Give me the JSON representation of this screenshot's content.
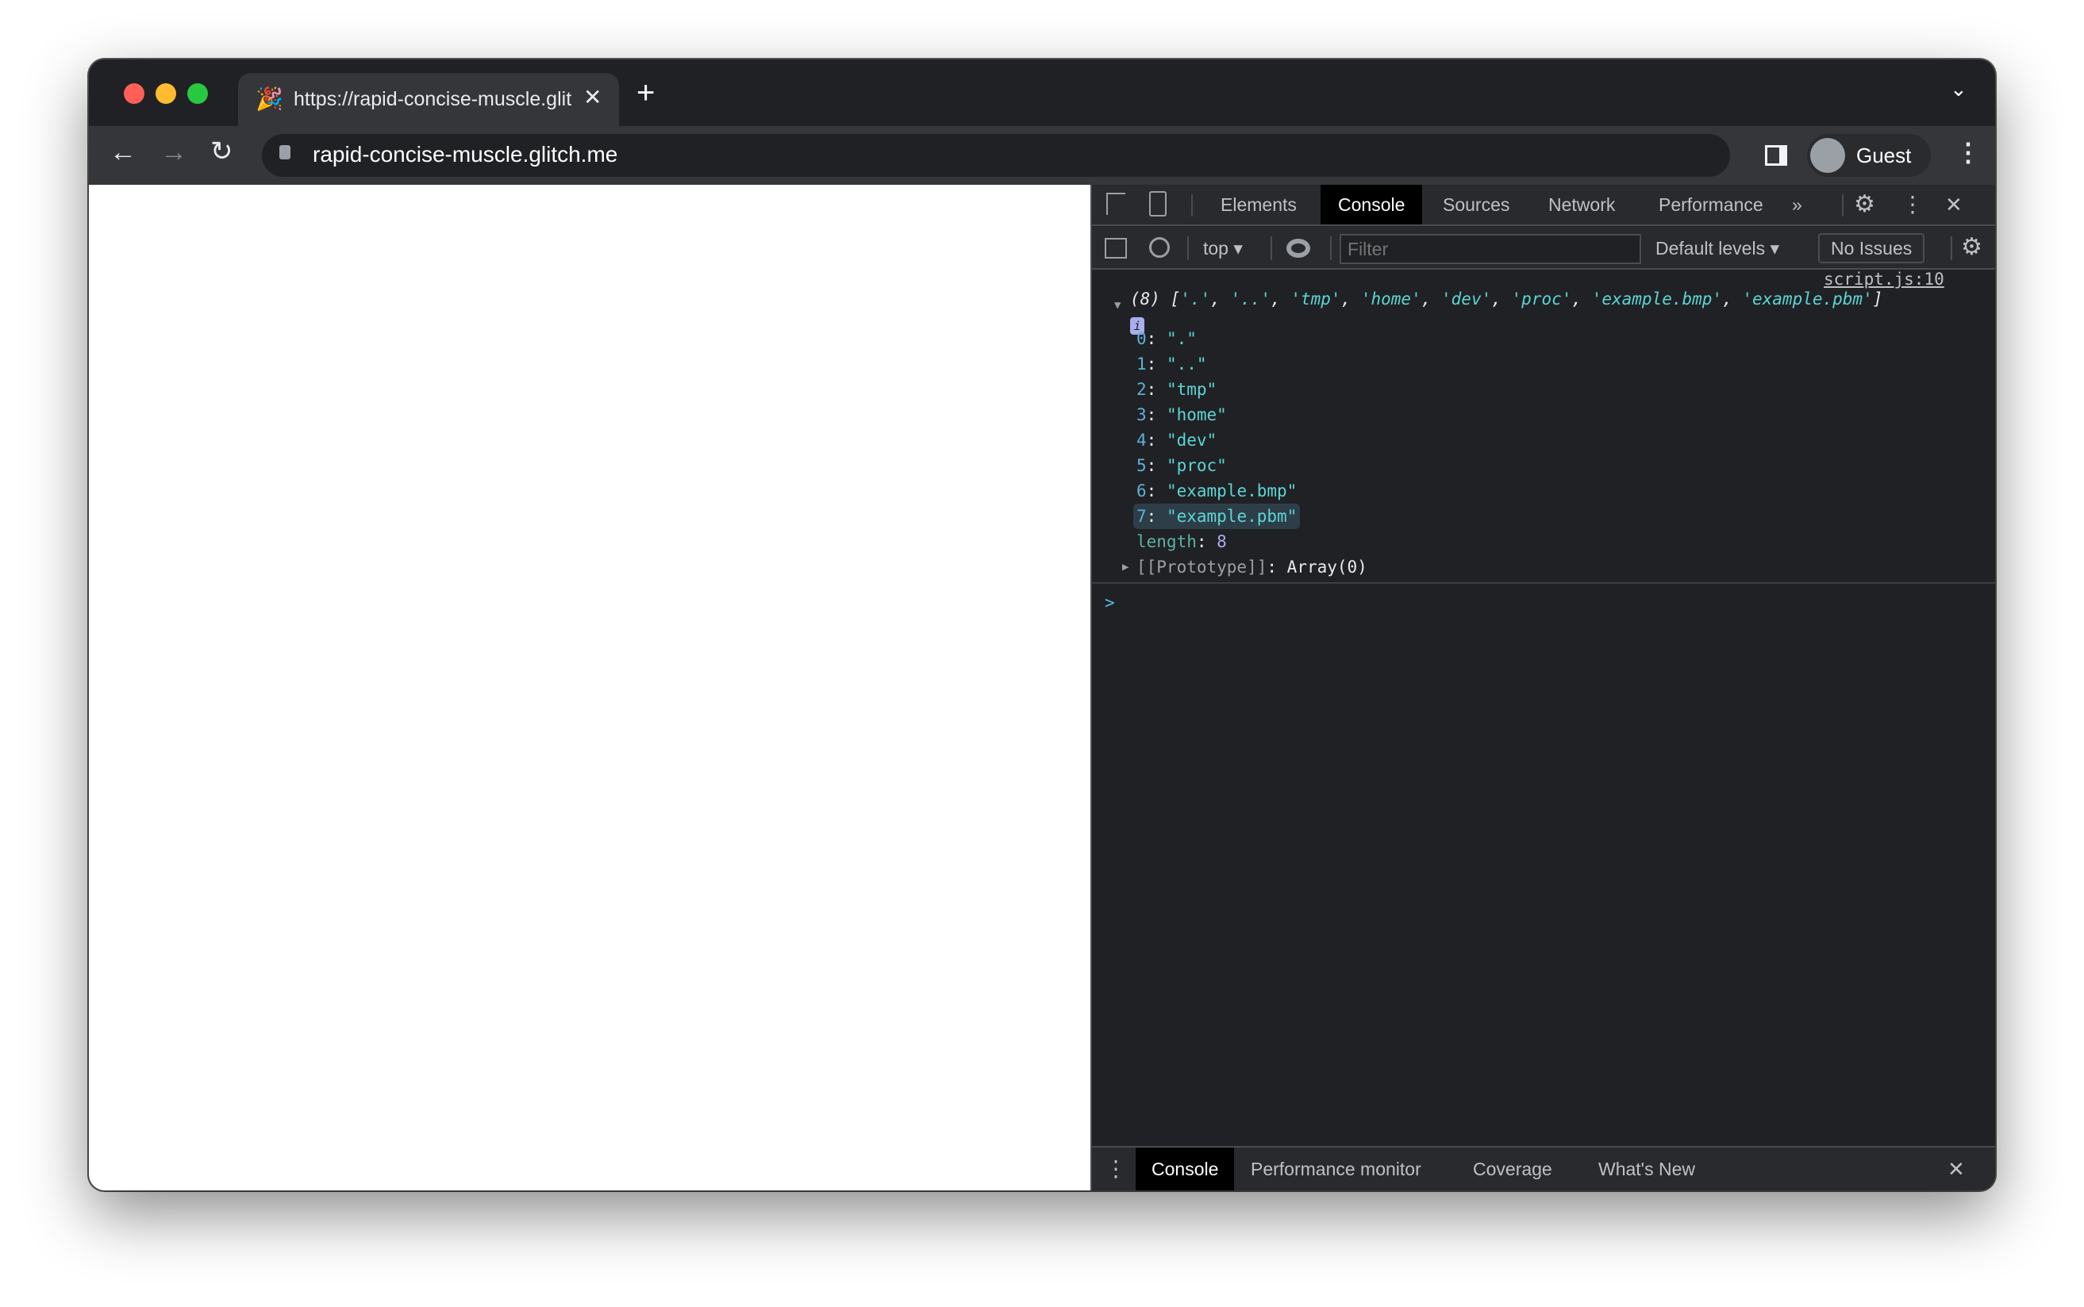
{
  "browser": {
    "tab_title": "https://rapid-concise-muscle.glitch.me",
    "url": "rapid-concise-muscle.glitch.me",
    "profile": "Guest",
    "colors": {
      "close": "#ff5f57",
      "minimize": "#febc2e",
      "maximize": "#28c840"
    }
  },
  "devtools": {
    "tabs": [
      "Elements",
      "Console",
      "Sources",
      "Network",
      "Performance"
    ],
    "active_tab": "Console",
    "context": "top",
    "filter_placeholder": "Filter",
    "levels": "Default levels",
    "issues": "No Issues",
    "console": {
      "source": "script.js:10",
      "summary_count": "(8)",
      "summary_items": [
        "'.'",
        "'..'",
        "'tmp'",
        "'home'",
        "'dev'",
        "'proc'",
        "'example.bmp'",
        "'example.pbm'"
      ],
      "items": [
        {
          "k": "0",
          "v": "\".\""
        },
        {
          "k": "1",
          "v": "\"..\""
        },
        {
          "k": "2",
          "v": "\"tmp\""
        },
        {
          "k": "3",
          "v": "\"home\""
        },
        {
          "k": "4",
          "v": "\"dev\""
        },
        {
          "k": "5",
          "v": "\"proc\""
        },
        {
          "k": "6",
          "v": "\"example.bmp\""
        },
        {
          "k": "7",
          "v": "\"example.pbm\""
        }
      ],
      "length_key": "length",
      "length_value": "8",
      "prototype_key": "[[Prototype]]",
      "prototype_value": "Array(0)",
      "prompt": ">"
    },
    "drawer_tabs": [
      "Console",
      "Performance monitor",
      "Coverage",
      "What's New"
    ]
  }
}
